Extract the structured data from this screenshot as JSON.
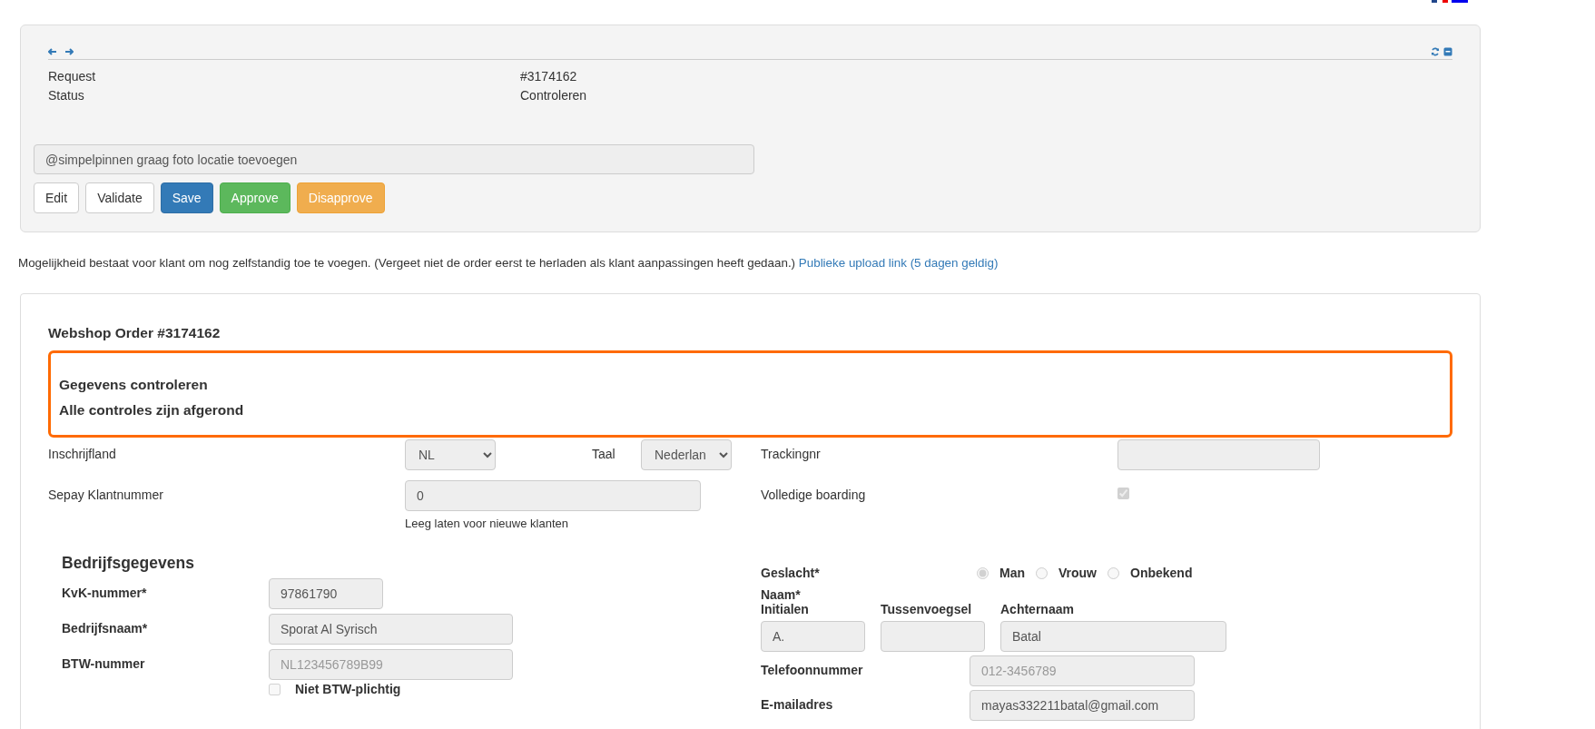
{
  "request_panel": {
    "info": [
      {
        "label": "Request",
        "value": "#3174162"
      },
      {
        "label": "Status",
        "value": "Controleren"
      }
    ],
    "comment": {
      "value": "@simpelpinnen graag foto locatie toevoegen"
    },
    "actions": [
      {
        "label": "Edit",
        "kind": "default"
      },
      {
        "label": "Validate",
        "kind": "default"
      },
      {
        "label": "Save",
        "kind": "primary"
      },
      {
        "label": "Approve",
        "kind": "success"
      },
      {
        "label": "Disapprove",
        "kind": "warning"
      }
    ]
  },
  "notice": {
    "text": "Mogelijkheid bestaat voor klant om nog zelfstandig toe te voegen. (Vergeet niet de order eerst te herladen als klant aanpassingen heeft gedaan.)",
    "link": "Publieke upload link (5 dagen geldig)"
  },
  "order": {
    "title": "Webshop Order #3174162",
    "alert": [
      "Gegevens controleren",
      "Alle controles zijn afgerond"
    ],
    "inschrijfland": {
      "label": "Inschrijfland",
      "value": "NL"
    },
    "taal": {
      "label": "Taal",
      "value": "Nederlan"
    },
    "klantnummer": {
      "label": "Sepay Klantnummer",
      "value": "0",
      "help": "Leeg laten voor nieuwe klanten"
    },
    "tracking": {
      "label": "Trackingnr"
    },
    "boarding": {
      "label": "Volledige boarding",
      "checked": true
    },
    "company": {
      "title": "Bedrijfsgegevens",
      "kvk": {
        "label": "KvK-nummer*",
        "value": "97861790"
      },
      "name": {
        "label": "Bedrijfsnaam*",
        "value": "Sporat Al Syrisch"
      },
      "btw": {
        "label": "BTW-nummer",
        "placeholder": "NL123456789B99"
      },
      "btw_exempt": {
        "label": "Niet BTW-plichtig",
        "checked": false
      }
    },
    "gender": {
      "label": "Geslacht*",
      "options": [
        {
          "label": "Man",
          "selected": true
        },
        {
          "label": "Vrouw",
          "selected": false
        },
        {
          "label": "Onbekend",
          "selected": false
        }
      ]
    },
    "naam": {
      "label": "Naam*",
      "parts": [
        {
          "label": "Initialen",
          "value": "A."
        },
        {
          "label": "Tussenvoegsel"
        },
        {
          "label": "Achternaam",
          "value": "Batal"
        }
      ]
    },
    "phone": {
      "label": "Telefoonnummer",
      "placeholder": "012-3456789"
    },
    "email": {
      "label": "E-mailadres",
      "value": "mayas332211batal@gmail.com"
    }
  }
}
